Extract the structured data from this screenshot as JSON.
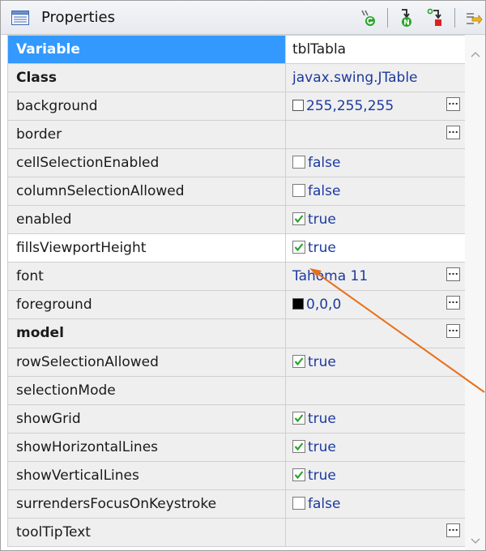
{
  "panel": {
    "title": "Properties",
    "toolbar": [
      {
        "icon": "show-events-icon"
      },
      {
        "icon": "go-to-definition-icon"
      },
      {
        "icon": "expand-properties-icon"
      },
      {
        "icon": "pin-properties-icon"
      },
      {
        "icon": "menu-icon"
      }
    ]
  },
  "rows": [
    {
      "name": "Variable",
      "value": "tblTabla",
      "bold": true,
      "selected": true
    },
    {
      "name": "Class",
      "value": "javax.swing.JTable",
      "bold": true,
      "blue": true
    },
    {
      "name": "background",
      "value": "255,255,255",
      "swatch": "#ffffff",
      "blue": true,
      "ellipsis": true
    },
    {
      "name": "border",
      "value": "",
      "ellipsis": true
    },
    {
      "name": "cellSelectionEnabled",
      "value": "false",
      "checkbox": false,
      "blue": true
    },
    {
      "name": "columnSelectionAllowed",
      "value": "false",
      "checkbox": false,
      "blue": true
    },
    {
      "name": "enabled",
      "value": "true",
      "checkbox": true,
      "blue": true
    },
    {
      "name": "fillsViewportHeight",
      "value": "true",
      "checkbox": true,
      "blue": true,
      "highlighted": true
    },
    {
      "name": "font",
      "value": "Tahoma 11",
      "blue": true,
      "ellipsis": true
    },
    {
      "name": "foreground",
      "value": "0,0,0",
      "swatch": "#000000",
      "blue": true,
      "ellipsis": true
    },
    {
      "name": "model",
      "value": "",
      "bold": true,
      "ellipsis": true
    },
    {
      "name": "rowSelectionAllowed",
      "value": "true",
      "checkbox": true,
      "blue": true
    },
    {
      "name": "selectionMode",
      "value": ""
    },
    {
      "name": "showGrid",
      "value": "true",
      "checkbox": true,
      "blue": true
    },
    {
      "name": "showHorizontalLines",
      "value": "true",
      "checkbox": true,
      "blue": true
    },
    {
      "name": "showVerticalLines",
      "value": "true",
      "checkbox": true,
      "blue": true
    },
    {
      "name": "surrendersFocusOnKeystroke",
      "value": "false",
      "checkbox": false,
      "blue": true
    },
    {
      "name": "toolTipText",
      "value": "",
      "ellipsis": true
    }
  ],
  "colors": {
    "selection": "#3399ff",
    "value_text": "#1c3a9e",
    "checkmark": "#2aa52a",
    "annotation_arrow": "#e8701a"
  }
}
